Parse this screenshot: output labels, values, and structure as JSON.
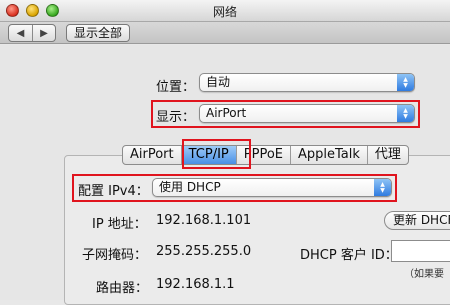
{
  "window": {
    "title": "网络"
  },
  "toolbar": {
    "back": "◀",
    "forward": "▶",
    "show_all": "显示全部"
  },
  "location": {
    "label": "位置：",
    "value": "自动"
  },
  "show": {
    "label": "显示：",
    "value": "AirPort"
  },
  "tabs": [
    {
      "label": "AirPort",
      "active": false
    },
    {
      "label": "TCP/IP",
      "active": true
    },
    {
      "label": "PPPoE",
      "active": false
    },
    {
      "label": "AppleTalk",
      "active": false
    },
    {
      "label": "代理",
      "active": false
    }
  ],
  "configure": {
    "label": "配置 IPv4：",
    "value": "使用 DHCP"
  },
  "ip": {
    "label": "IP 地址：",
    "value": "192.168.1.101"
  },
  "renew_button": "更新 DHCF",
  "subnet": {
    "label": "子网掩码：",
    "value": "255.255.255.0"
  },
  "dhcp_client": {
    "label": "DHCP 客户 ID：",
    "value": "",
    "hint": "（如果要"
  },
  "router": {
    "label": "路由器：",
    "value": "192.168.1.1"
  },
  "colors": {
    "highlight": "#e0141e",
    "accent": "#4a90e6"
  }
}
